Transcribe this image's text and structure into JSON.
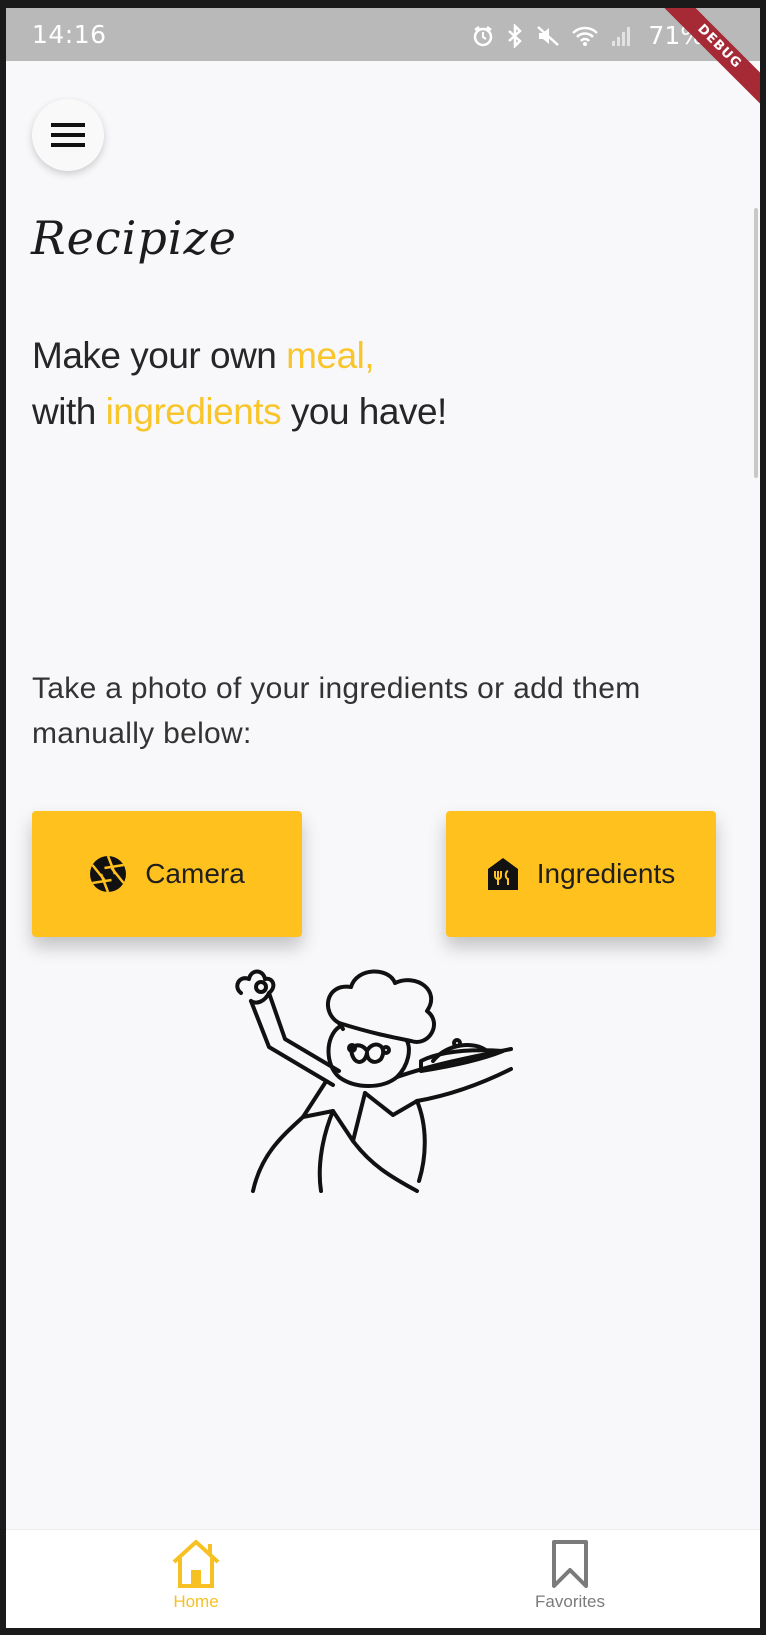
{
  "status_bar": {
    "time": "14:16",
    "battery": "71%",
    "debug_label": "DEBUG"
  },
  "app": {
    "title": "Recipize"
  },
  "headline": {
    "line1_prefix": "Make your own ",
    "line1_accent": "meal,",
    "line2_prefix": "with ",
    "line2_accent": "ingredients",
    "line2_suffix": " you have!"
  },
  "instruction": "Take a photo of your ingredients or add them manually below:",
  "buttons": {
    "camera_label": "Camera",
    "ingredients_label": "Ingredients"
  },
  "bottom_nav": {
    "items": [
      {
        "label": "Home",
        "icon": "home-icon",
        "active": true
      },
      {
        "label": "Favorites",
        "icon": "bookmark-icon",
        "active": false
      }
    ]
  },
  "colors": {
    "accent": "#ffc11d",
    "accent_text": "#f8c52a",
    "inactive": "#7b7b7b"
  }
}
